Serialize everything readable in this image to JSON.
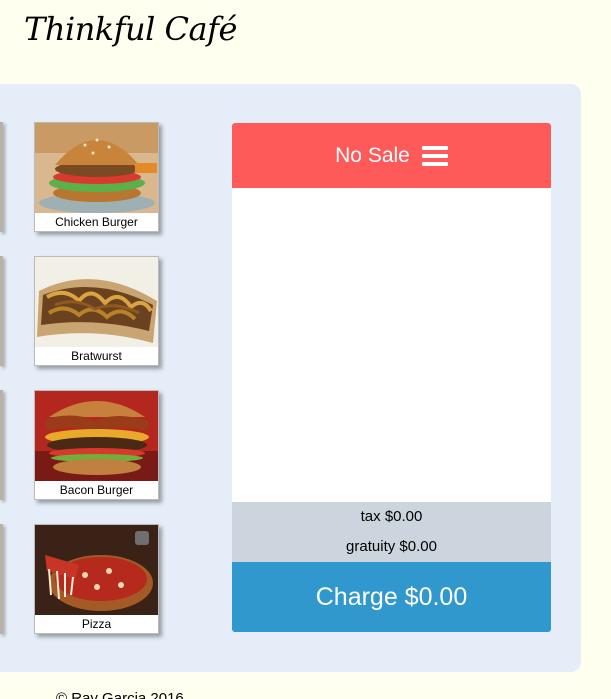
{
  "app": {
    "title": "Thinkful Café"
  },
  "menu": {
    "items": [
      {
        "name": "Chicken Burger"
      },
      {
        "name": "Bratwurst"
      },
      {
        "name": "Bacon Burger"
      },
      {
        "name": "Pizza"
      }
    ]
  },
  "order": {
    "header_label": "No Sale",
    "header_icon": "menu-icon",
    "tax_label": "tax $0.00",
    "gratuity_label": "gratuity $0.00",
    "charge_label": "Charge $0.00"
  },
  "colors": {
    "order_header": "#ff5a5a",
    "charge_button": "#3198cd",
    "totals_bg": "#ccd5dd",
    "panel_bg": "#e5eef8",
    "page_bg": "#fffff0"
  },
  "footer": {
    "copyright": "© Ray Garcia 2016"
  }
}
